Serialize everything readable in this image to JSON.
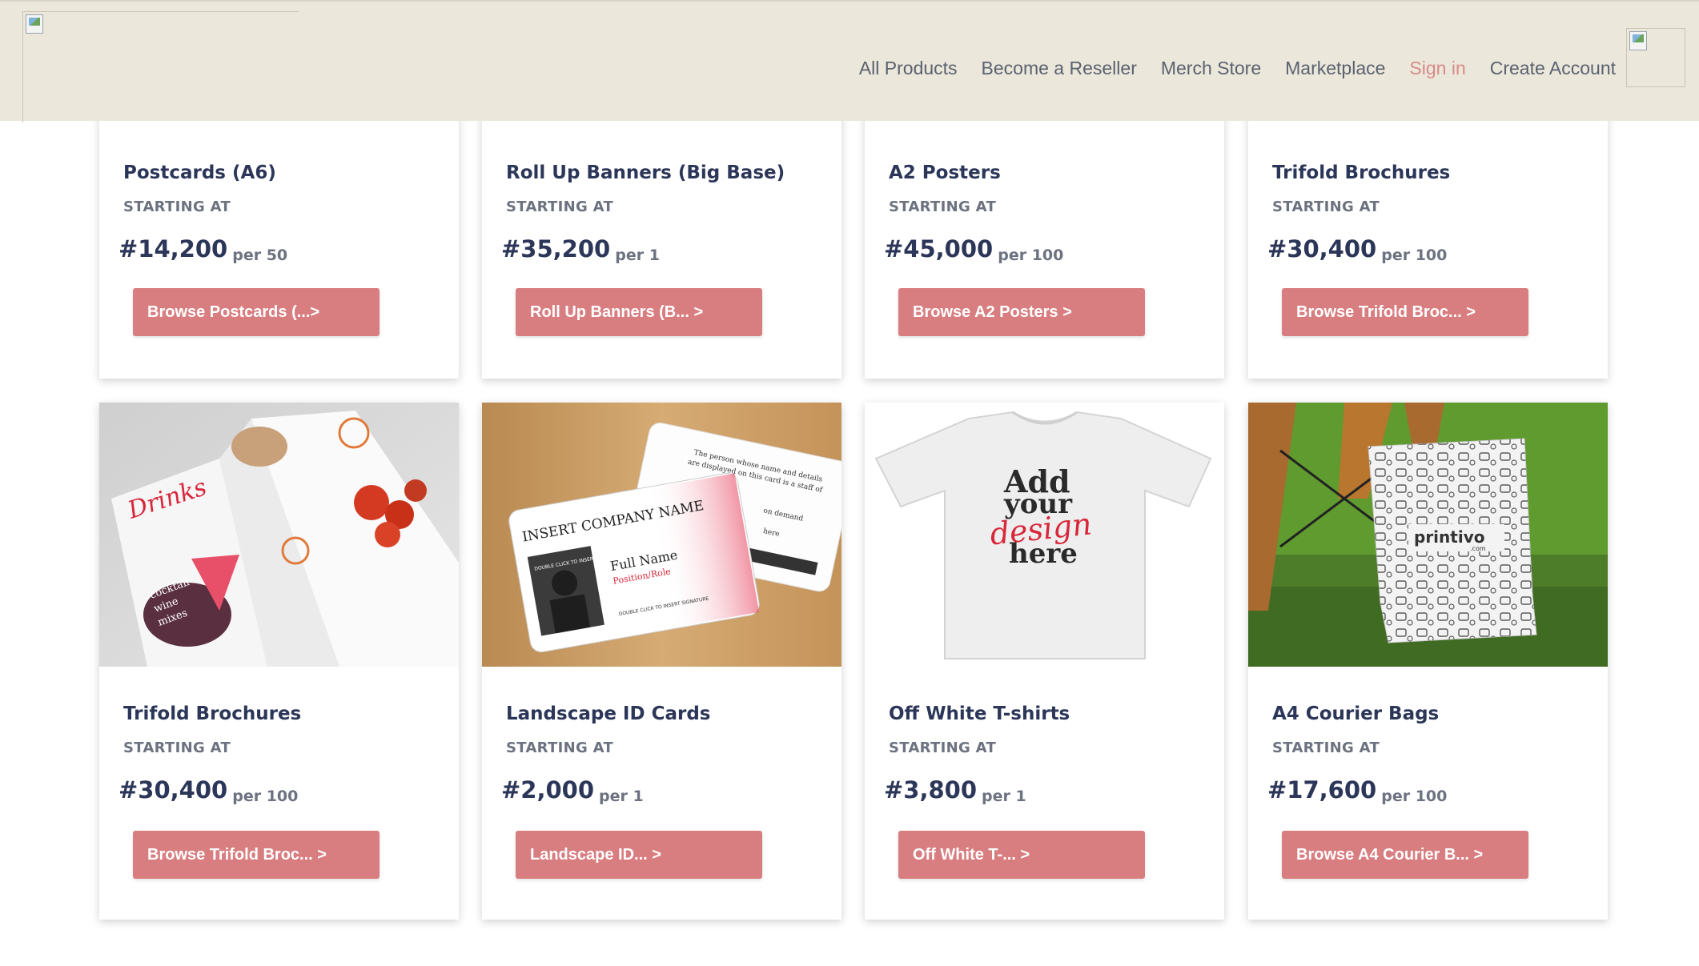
{
  "header": {
    "nav": [
      "All Products",
      "Become a Reseller",
      "Merch Store",
      "Marketplace",
      "Sign in",
      "Create Account"
    ],
    "colors": {
      "background": "#ebe7da",
      "signin": "#d98a8a",
      "nav": "#5a6270"
    }
  },
  "cards": [
    {
      "title": "Postcards (A6)",
      "starting": "STARTING AT",
      "price": "#14,200",
      "unit": "per 50",
      "button": "Browse Postcards (...>"
    },
    {
      "title": "Roll Up Banners (Big Base)",
      "starting": "STARTING AT",
      "price": "#35,200",
      "unit": "per 1",
      "button": "Roll Up Banners (B... >"
    },
    {
      "title": "A2 Posters",
      "starting": "STARTING AT",
      "price": "#45,000",
      "unit": "per 100",
      "button": "Browse A2 Posters >"
    },
    {
      "title": "Trifold Brochures",
      "starting": "STARTING AT",
      "price": "#30,400",
      "unit": "per 100",
      "button": "Browse Trifold Broc... >"
    },
    {
      "title": "Trifold Brochures",
      "starting": "STARTING AT",
      "price": "#30,400",
      "unit": "per 100",
      "button": "Browse Trifold Broc... >"
    },
    {
      "title": "Landscape ID Cards",
      "starting": "STARTING AT",
      "price": "#2,000",
      "unit": "per 1",
      "button": "Landscape ID... >"
    },
    {
      "title": "Off White T-shirts",
      "starting": "STARTING AT",
      "price": "#3,800",
      "unit": "per 1",
      "button": "Off White T-... >"
    },
    {
      "title": "A4 Courier Bags",
      "starting": "STARTING AT",
      "price": "#17,600",
      "unit": "per 100",
      "button": "Browse A4 Courier B... >"
    }
  ],
  "images": {
    "brochure": {
      "script": "Drinks",
      "lines": [
        "cocktail",
        "wine",
        "mixes"
      ]
    },
    "idcard": {
      "company": "INSERT COMPANY NAME",
      "name": "Full Name",
      "role": "Position/Role",
      "photo": "DOUBLE CLICK TO INSERT PASSPORT",
      "sign": "DOUBLE CLICK TO INSERT SIGNATURE",
      "back1": "The person whose name and details",
      "back2": "are displayed on this card is a staff of",
      "back3": "on demand",
      "back4": "here"
    },
    "tshirt": {
      "l1": "Add",
      "l2": "your",
      "l3": "design",
      "l4": "here"
    },
    "bag": {
      "brand": "printivo",
      "sub": ".com"
    }
  },
  "accent": "#d97e80"
}
